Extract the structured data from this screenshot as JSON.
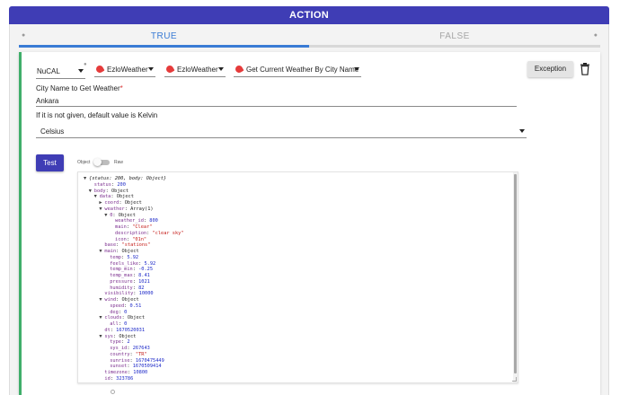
{
  "header": {
    "title": "ACTION"
  },
  "tabs": [
    {
      "label": "TRUE"
    },
    {
      "label": "FALSE"
    }
  ],
  "selectors": {
    "source": "NuCAL",
    "plugin": "EzloWeather",
    "account": "EzloWeather",
    "action": "Get Current Weather By City Name"
  },
  "buttons": {
    "exception": "Exception",
    "test": "Test"
  },
  "fields": {
    "city_label": "City Name to Get Weather",
    "required_mark": "*",
    "city_value": "Ankara",
    "unit_hint": "If it is not given, default value is Kelvin",
    "unit_value": "Celsius"
  },
  "toggle": {
    "left": "Object",
    "right": "Raw"
  },
  "colors": {
    "header": "#3f3db5",
    "accent": "#3a7bd5",
    "card_border": "#3fae6a",
    "test_button": "#3f3db5"
  },
  "icons": {
    "plugin": "weather-plugin-icon",
    "delete": "trash-icon"
  },
  "json_tree": [
    {
      "lvl": 0,
      "tri": "▼",
      "root": "{status: 200, body: Object}"
    },
    {
      "lvl": 1,
      "key": "status",
      "val": "200",
      "t": "n"
    },
    {
      "lvl": 1,
      "tri": "▼",
      "key": "body",
      "val": "Object",
      "t": "p"
    },
    {
      "lvl": 2,
      "tri": "▼",
      "key": "data",
      "val": "Object",
      "t": "p"
    },
    {
      "lvl": 3,
      "tri": "▶",
      "key": "coord",
      "val": "Object",
      "t": "p"
    },
    {
      "lvl": 3,
      "tri": "▼",
      "key": "weather",
      "val": "Array(1)",
      "t": "p"
    },
    {
      "lvl": 4,
      "tri": "▼",
      "key": "0",
      "val": "Object",
      "t": "p"
    },
    {
      "lvl": 5,
      "key": "weather_id",
      "val": "800",
      "t": "n"
    },
    {
      "lvl": 5,
      "key": "main",
      "val": "\"Clear\"",
      "t": "s"
    },
    {
      "lvl": 5,
      "key": "description",
      "val": "\"clear sky\"",
      "t": "s"
    },
    {
      "lvl": 5,
      "key": "icon",
      "val": "\"01n\"",
      "t": "s"
    },
    {
      "lvl": 3,
      "key": "base",
      "val": "\"stations\"",
      "t": "s"
    },
    {
      "lvl": 3,
      "tri": "▼",
      "key": "main",
      "val": "Object",
      "t": "p"
    },
    {
      "lvl": 4,
      "key": "temp",
      "val": "5.92",
      "t": "n"
    },
    {
      "lvl": 4,
      "key": "feels_like",
      "val": "5.92",
      "t": "n"
    },
    {
      "lvl": 4,
      "key": "temp_min",
      "val": "-0.25",
      "t": "n"
    },
    {
      "lvl": 4,
      "key": "temp_max",
      "val": "8.41",
      "t": "n"
    },
    {
      "lvl": 4,
      "key": "pressure",
      "val": "1021",
      "t": "n"
    },
    {
      "lvl": 4,
      "key": "humidity",
      "val": "82",
      "t": "n"
    },
    {
      "lvl": 3,
      "key": "visibility",
      "val": "10000",
      "t": "n"
    },
    {
      "lvl": 3,
      "tri": "▼",
      "key": "wind",
      "val": "Object",
      "t": "p"
    },
    {
      "lvl": 4,
      "key": "speed",
      "val": "0.51",
      "t": "n"
    },
    {
      "lvl": 4,
      "key": "deg",
      "val": "0",
      "t": "n"
    },
    {
      "lvl": 3,
      "tri": "▼",
      "key": "clouds",
      "val": "Object",
      "t": "p"
    },
    {
      "lvl": 4,
      "key": "all",
      "val": "0",
      "t": "n"
    },
    {
      "lvl": 3,
      "key": "dt",
      "val": "1670520031",
      "t": "n"
    },
    {
      "lvl": 3,
      "tri": "▼",
      "key": "sys",
      "val": "Object",
      "t": "p"
    },
    {
      "lvl": 4,
      "key": "type",
      "val": "2",
      "t": "n"
    },
    {
      "lvl": 4,
      "key": "sys_id",
      "val": "267643",
      "t": "n"
    },
    {
      "lvl": 4,
      "key": "country",
      "val": "\"TR\"",
      "t": "s"
    },
    {
      "lvl": 4,
      "key": "sunrise",
      "val": "1670475449",
      "t": "n"
    },
    {
      "lvl": 4,
      "key": "sunset",
      "val": "1670509414",
      "t": "n"
    },
    {
      "lvl": 3,
      "key": "timezone",
      "val": "10800",
      "t": "n"
    },
    {
      "lvl": 3,
      "key": "id",
      "val": "323786",
      "t": "n"
    }
  ]
}
